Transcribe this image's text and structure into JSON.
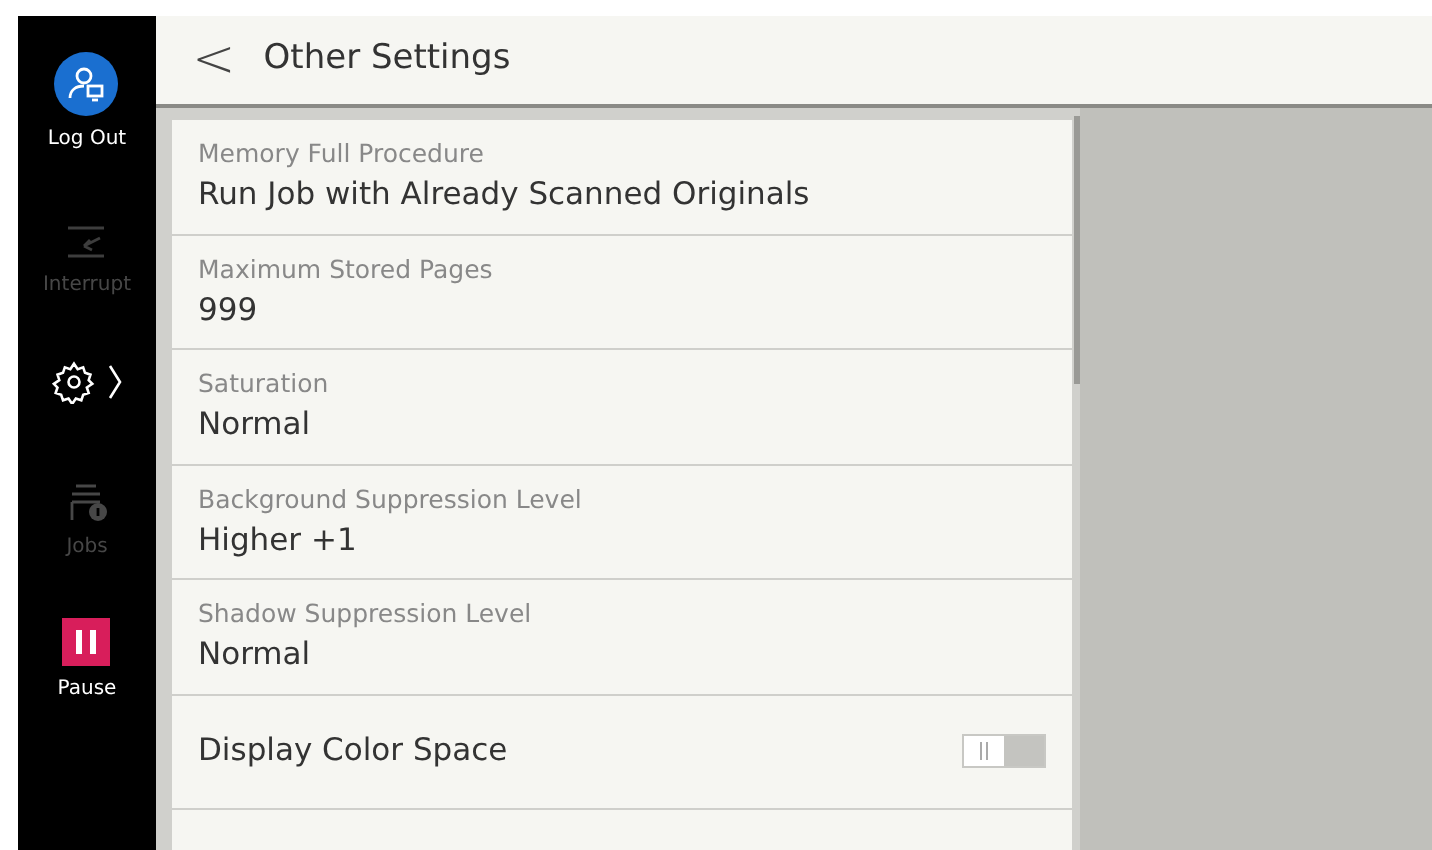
{
  "sidebar": {
    "items": [
      {
        "kind": "user",
        "label": "Log Out",
        "disabled": false
      },
      {
        "kind": "interrupt",
        "label": "Interrupt",
        "disabled": true
      },
      {
        "kind": "settings"
      },
      {
        "kind": "jobs",
        "label": "Jobs",
        "disabled": true
      },
      {
        "kind": "pause",
        "label": "Pause",
        "disabled": false
      }
    ]
  },
  "header": {
    "back": "<",
    "title": "Other Settings"
  },
  "settings": [
    {
      "kind": "value",
      "label": "Memory Full Procedure",
      "value": "Run Job with Already Scanned Originals"
    },
    {
      "kind": "value",
      "label": "Maximum Stored Pages",
      "value": "999"
    },
    {
      "kind": "value",
      "label": "Saturation",
      "value": "Normal"
    },
    {
      "kind": "value",
      "label": "Background Suppression Level",
      "value": "Higher +1"
    },
    {
      "kind": "value",
      "label": "Shadow Suppression Level",
      "value": "Normal"
    },
    {
      "kind": "toggle",
      "label": "Display Color Space",
      "on": false
    }
  ]
}
